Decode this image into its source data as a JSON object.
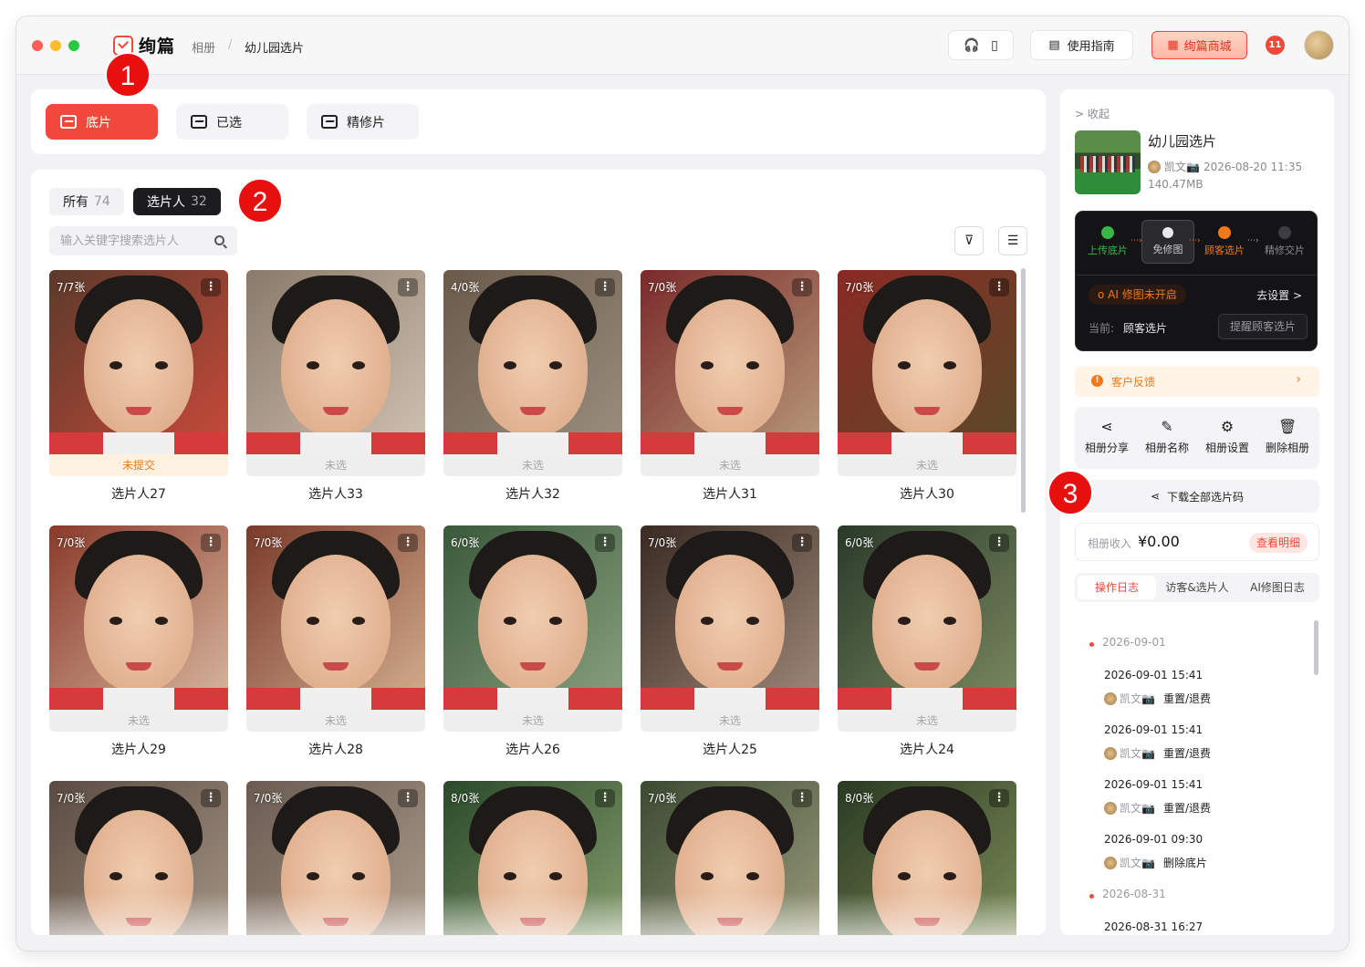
{
  "window": {
    "logo_text": "绚篇",
    "breadcrumb": [
      "相册",
      "/",
      "幼儿园选片"
    ]
  },
  "toolbar": {
    "guide_label": "使用指南",
    "shop_label": "绚篇商城",
    "badge": "11"
  },
  "tabs": [
    {
      "label": "底片",
      "active": true
    },
    {
      "label": "已选",
      "active": false
    },
    {
      "label": "精修片",
      "active": false
    }
  ],
  "filters": {
    "all_label": "所有",
    "all_count": "74",
    "selector_label": "选片人",
    "selector_count": "32",
    "search_placeholder": "输入关键字搜索选片人"
  },
  "grid": [
    {
      "count": "7/7张",
      "status": "未提交",
      "name": "选片人27"
    },
    {
      "count": "",
      "status": "未选",
      "name": "选片人33"
    },
    {
      "count": "4/0张",
      "status": "未选",
      "name": "选片人32"
    },
    {
      "count": "7/0张",
      "status": "未选",
      "name": "选片人31"
    },
    {
      "count": "7/0张",
      "status": "未选",
      "name": "选片人30"
    },
    {
      "count": "7/0张",
      "status": "未选",
      "name": "选片人29"
    },
    {
      "count": "7/0张",
      "status": "未选",
      "name": "选片人28"
    },
    {
      "count": "6/0张",
      "status": "未选",
      "name": "选片人26"
    },
    {
      "count": "7/0张",
      "status": "未选",
      "name": "选片人25"
    },
    {
      "count": "6/0张",
      "status": "未选",
      "name": "选片人24"
    },
    {
      "count": "7/0张",
      "status": "",
      "name": ""
    },
    {
      "count": "7/0张",
      "status": "",
      "name": ""
    },
    {
      "count": "8/0张",
      "status": "",
      "name": ""
    },
    {
      "count": "7/0张",
      "status": "",
      "name": ""
    },
    {
      "count": "8/0张",
      "status": "",
      "name": ""
    }
  ],
  "panel": {
    "collapse_label": "> 收起",
    "album_title": "幼儿园选片",
    "album_owner": "凯文📷",
    "album_date": "2026-08-20 11:35",
    "album_size": "140.47MB",
    "workflow": {
      "steps": [
        "上传底片",
        "免修图",
        "顾客选片",
        "精修交片"
      ],
      "ai_status": "o AI 修图未开启",
      "go_settings": "去设置 >",
      "current_label": "当前:",
      "current_value": "顾客选片",
      "remind_button": "提醒顾客选片"
    },
    "feedback_label": "客户反馈",
    "actions": [
      "相册分享",
      "相册名称",
      "相册设置",
      "删除相册"
    ],
    "download_label": "下载全部选片码",
    "income_label": "相册收入",
    "income_value": "¥0.00",
    "income_detail": "查看明细",
    "log_tabs": [
      "操作日志",
      "访客&选片人",
      "AI修图日志"
    ],
    "log": {
      "date1": "2026-09-01",
      "entries1": [
        {
          "time": "2026-09-01 15:41",
          "who": "凯文📷",
          "what": "重置/退费"
        },
        {
          "time": "2026-09-01 15:41",
          "who": "凯文📷",
          "what": "重置/退费"
        },
        {
          "time": "2026-09-01 15:41",
          "who": "凯文📷",
          "what": "重置/退费"
        },
        {
          "time": "2026-09-01 09:30",
          "who": "凯文📷",
          "what": "删除底片"
        }
      ],
      "date2": "2026-08-31",
      "entries2": [
        {
          "time": "2026-08-31 16:27"
        }
      ]
    }
  },
  "markers": [
    "1",
    "2",
    "3"
  ],
  "colors": {
    "accent": "#f0483a",
    "orange": "#f07a1a",
    "dark": "#141416"
  }
}
